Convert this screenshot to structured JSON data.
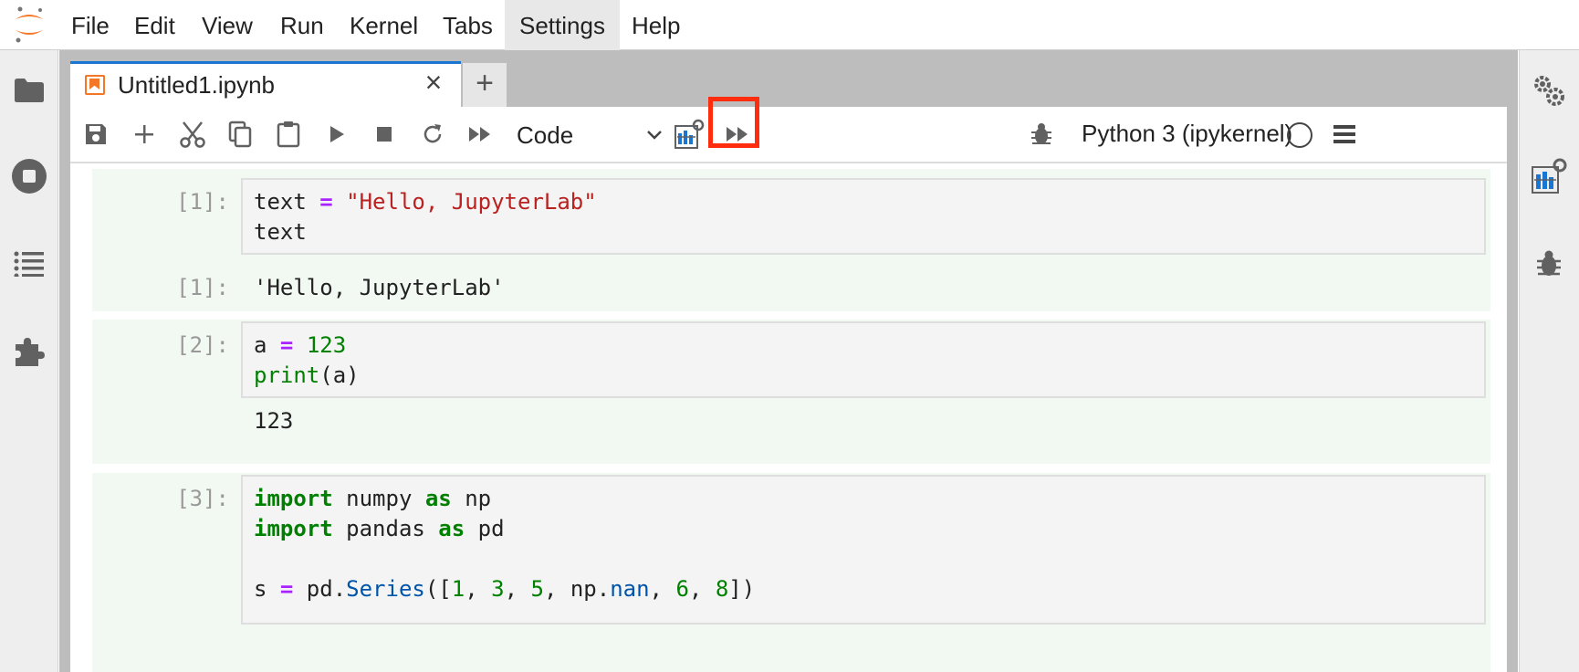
{
  "menu": {
    "items": [
      "File",
      "Edit",
      "View",
      "Run",
      "Kernel",
      "Tabs",
      "Settings",
      "Help"
    ],
    "active": "Settings"
  },
  "tab": {
    "title": "Untitled1.ipynb",
    "close_label": "×",
    "add_label": "+"
  },
  "toolbar": {
    "cell_type": "Code",
    "kernel": "Python 3 (ipykernel)"
  },
  "cells": [
    {
      "prompt": "[1]:",
      "code": [
        "text = \"Hello, JupyterLab\"",
        "text"
      ],
      "output_prompt": "[1]:",
      "output": "'Hello, JupyterLab'"
    },
    {
      "prompt": "[2]:",
      "code": [
        "a = 123",
        "print(a)"
      ],
      "output": "123"
    },
    {
      "prompt": "[3]:",
      "code": [
        "import numpy as np",
        "import pandas as pd",
        "",
        "s = pd.Series([1, 3, 5, np.nan, 6, 8])"
      ]
    }
  ],
  "colors": {
    "highlight": "#ff2d0e",
    "tab_accent": "#1976d2",
    "jupyter_orange": "#f37726"
  }
}
